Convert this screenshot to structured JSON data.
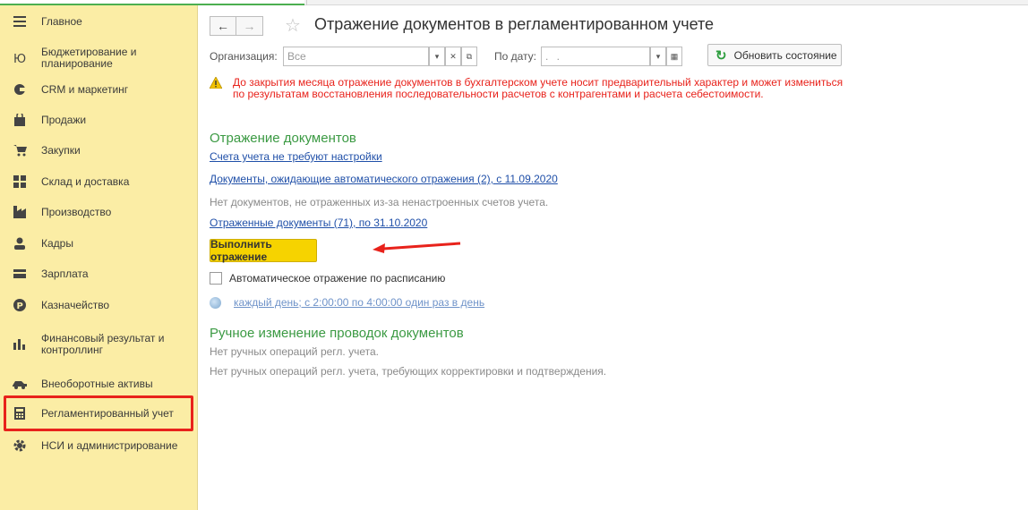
{
  "sidebar": {
    "items": [
      {
        "label": "Главное",
        "icon": "menu-lines-icon"
      },
      {
        "label": "Бюджетирование и\nпланирование",
        "icon": "budget-icon"
      },
      {
        "label": "CRM и маркетинг",
        "icon": "crm-icon"
      },
      {
        "label": "Продажи",
        "icon": "shopping-bag-icon"
      },
      {
        "label": "Закупки",
        "icon": "cart-icon"
      },
      {
        "label": "Склад и доставка",
        "icon": "warehouse-icon"
      },
      {
        "label": "Производство",
        "icon": "factory-icon"
      },
      {
        "label": "Кадры",
        "icon": "person-icon"
      },
      {
        "label": "Зарплата",
        "icon": "wallet-icon"
      },
      {
        "label": "Казначейство",
        "icon": "ruble-coin-icon"
      },
      {
        "label": "Финансовый результат и\nконтроллинг",
        "icon": "bar-chart-icon"
      },
      {
        "label": "Внеоборотные активы",
        "icon": "truck-icon"
      },
      {
        "label": "Регламентированный учет",
        "icon": "calculator-icon"
      },
      {
        "label": "НСИ и администрирование",
        "icon": "gear-icon"
      }
    ]
  },
  "header": {
    "back_label": "←",
    "forward_label": "→",
    "star_label": "☆",
    "title": "Отражение документов в регламентированном учете"
  },
  "filters": {
    "org_label": "Организация:",
    "org_placeholder": "Все",
    "date_label": "По дату:",
    "date_placeholder": ". .",
    "refresh_label": "Обновить состояние"
  },
  "warning": {
    "text": "До закрытия месяца отражение документов в бухгалтерском учете носит предварительный характер и может измениться\nпо результатам восстановления последовательности расчетов с контрагентами и расчета себестоимости."
  },
  "reflection": {
    "heading": "Отражение документов",
    "accounts_link": "Счета учета не требуют настройки",
    "awaiting_link": "Документы, ожидающие автоматического отражения (2), с 11.09.2020",
    "no_docs_text": "Нет документов, не отраженных из-за ненастроенных счетов учета.",
    "reflected_link": "Отраженные документы (71), по 31.10.2020",
    "execute_label": "Выполнить отражение",
    "auto_label": "Автоматическое отражение по расписанию",
    "auto_checked": false,
    "schedule_link": "каждый день; с 2:00:00 по 4:00:00 один раз в день"
  },
  "manual": {
    "heading": "Ручное изменение проводок документов",
    "no_ops_text": "Нет ручных операций регл. учета.",
    "no_ops_correction_text": "Нет ручных операций регл. учета, требующих корректировки и подтверждения."
  },
  "colors": {
    "sidebar_bg": "#fbeda5",
    "accent_green": "#3b9a43",
    "warning_red": "#e8221b",
    "link_blue": "#1f4fa8",
    "button_yellow": "#f6d300"
  }
}
